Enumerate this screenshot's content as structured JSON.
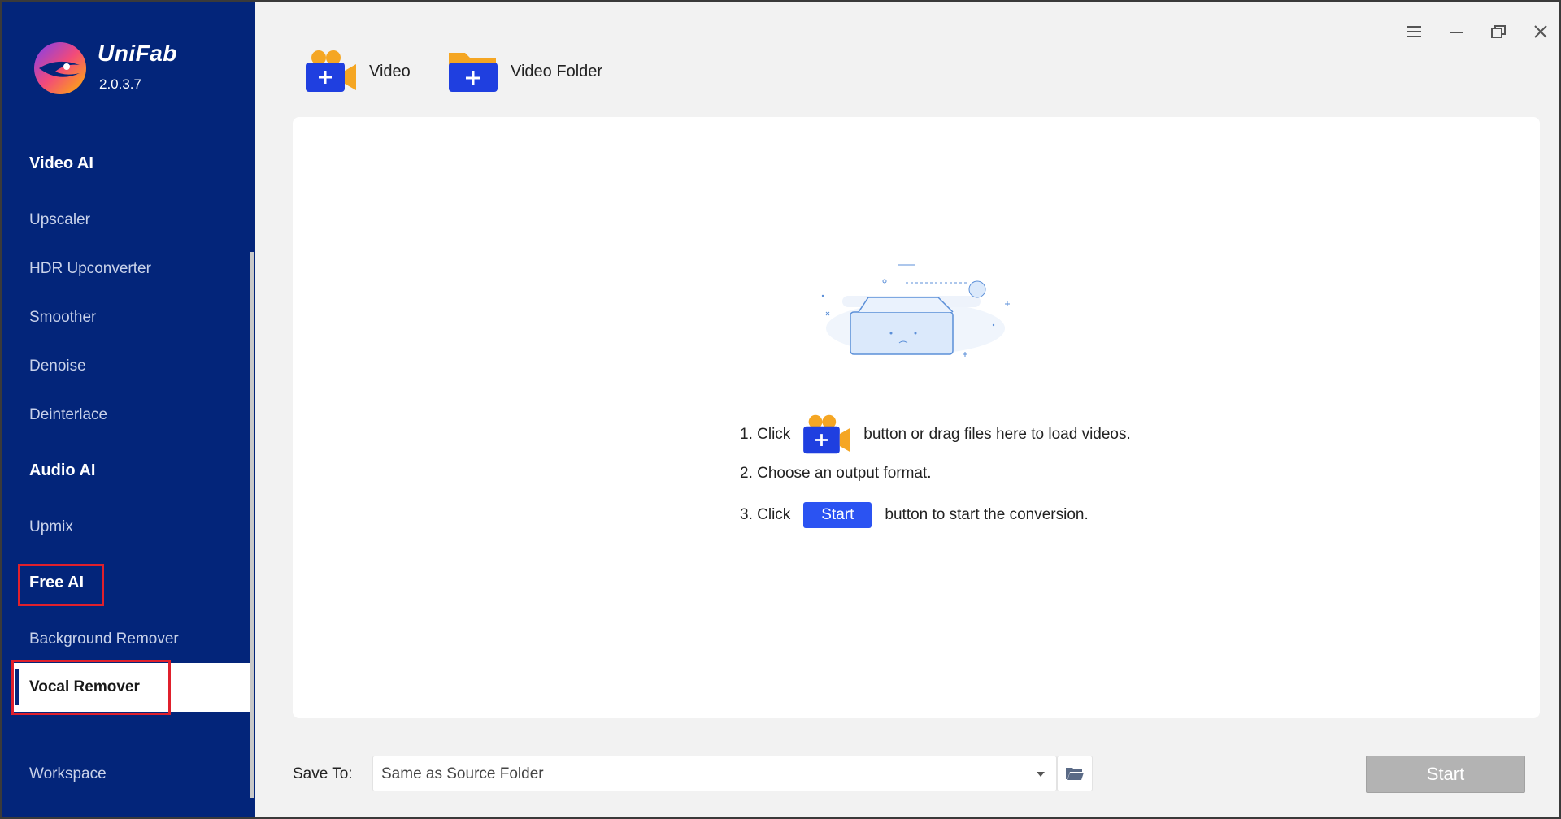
{
  "brand": {
    "name": "UniFab",
    "version": "2.0.3.7"
  },
  "sidebar": {
    "sections": [
      {
        "title": "Video AI",
        "items": [
          "Upscaler",
          "HDR Upconverter",
          "Smoother",
          "Denoise",
          "Deinterlace"
        ]
      },
      {
        "title": "Audio AI",
        "items": [
          "Upmix"
        ]
      },
      {
        "title": "Free AI",
        "items": [
          "Background Remover",
          "Vocal Remover"
        ]
      }
    ],
    "active_item": "Vocal Remover",
    "footer_item": "Workspace"
  },
  "toolbar": {
    "video_label": "Video",
    "video_folder_label": "Video Folder"
  },
  "instructions": {
    "step1_prefix": "1. Click",
    "step1_suffix": "button or drag files here to load videos.",
    "step2": "2. Choose an output format.",
    "step3_prefix": "3. Click",
    "step3_chip": "Start",
    "step3_suffix": "button to start the conversion."
  },
  "save_to": {
    "label": "Save To:",
    "value": "Same as Source Folder"
  },
  "start_button": "Start",
  "colors": {
    "sidebar_bg": "#03257a",
    "accent_blue": "#2b53f2",
    "highlight_red": "#e0202c",
    "disabled_gray": "#b3b3b3"
  },
  "icons": {
    "window": [
      "menu-icon",
      "minimize-icon",
      "restore-icon",
      "close-icon"
    ],
    "toolbar": [
      "add-video-icon",
      "add-video-folder-icon"
    ],
    "save": "folder-open-icon"
  }
}
